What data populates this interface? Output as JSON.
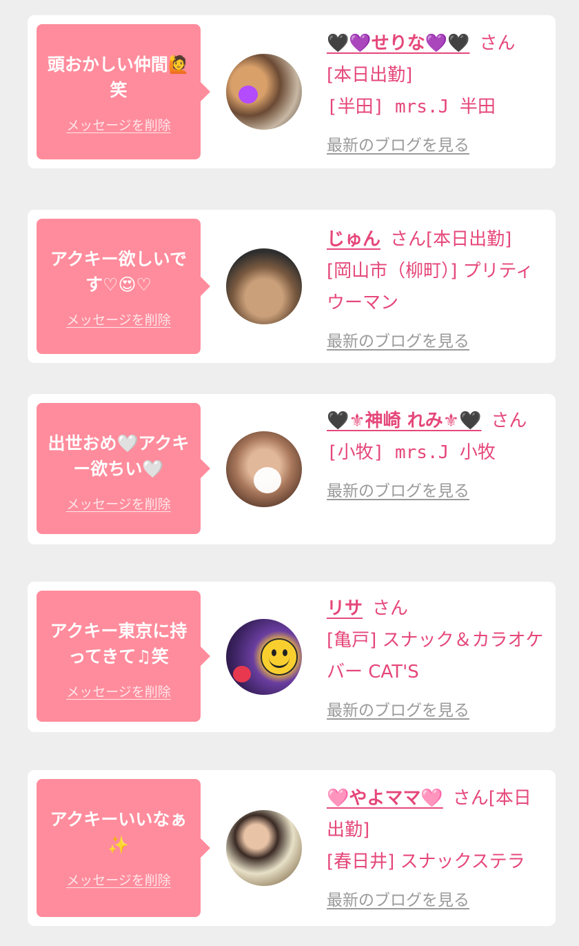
{
  "delete_label": "メッセージを削除",
  "blog_label": "最新のブログを見る",
  "san": "さん",
  "cards": [
    {
      "message": "頭おかしい仲間🙋笑",
      "name": "🖤💜せりな💜🖤",
      "status": "[本日出勤]",
      "shop": "[半田] mrs.J 半田"
    },
    {
      "message": "アクキー欲しいです♡😍♡",
      "name": "じゅん",
      "status": "[本日出勤]",
      "shop": "[岡山市（柳町）] プリティウーマン"
    },
    {
      "message": "出世おめ🤍アクキー欲ちい🤍",
      "name": "🖤⚜神崎 れみ⚜🖤",
      "status": "",
      "shop": "[小牧] mrs.J 小牧"
    },
    {
      "message": "アクキー東京に持ってきて♫笑",
      "name": "リサ",
      "status": "",
      "shop": "[亀戸] スナック＆カラオケバー CAT'S"
    },
    {
      "message": "アクキーいいなぁ✨",
      "name": "🩷やよママ🩷",
      "status": "[本日出勤]",
      "shop": "[春日井] スナックステラ"
    }
  ],
  "colors": {
    "bubble": "#ff8c9c",
    "accent": "#e5477a",
    "link_gray": "#9a9a9a",
    "background": "#eeeeee"
  }
}
